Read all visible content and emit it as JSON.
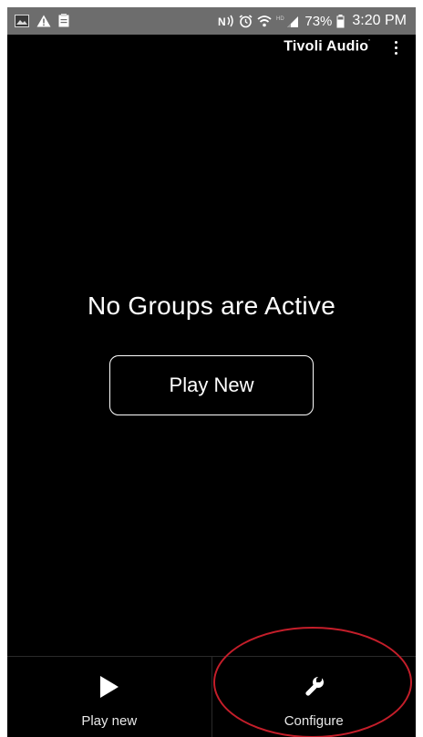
{
  "status_bar": {
    "time": "3:20 PM",
    "battery_percent": "73%",
    "network_label": "HD",
    "icons_left": [
      "image-icon",
      "warning-icon",
      "clipboard-icon"
    ],
    "icons_right": [
      "nfc-icon",
      "alarm-icon",
      "wifi-icon",
      "signal-icon",
      "battery-icon"
    ]
  },
  "header": {
    "brand": "Tivoli Audio",
    "brand_mark": "'",
    "menu_icon": "more-vertical-icon"
  },
  "main": {
    "empty_title": "No Groups are Active",
    "play_new_button_label": "Play New"
  },
  "bottom_nav": {
    "items": [
      {
        "label": "Play new",
        "icon": "play-icon"
      },
      {
        "label": "Configure",
        "icon": "wrench-icon"
      }
    ]
  },
  "annotation": {
    "color": "#c41e2a",
    "shape": "ellipse",
    "target": "Configure"
  },
  "colors": {
    "background": "#000000",
    "status_bar": "#6d6d6d",
    "text": "#ffffff"
  }
}
